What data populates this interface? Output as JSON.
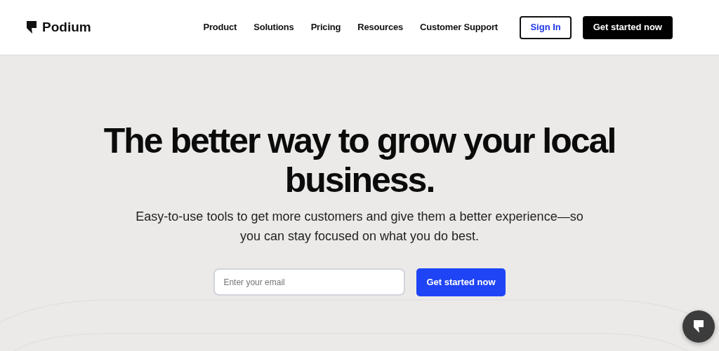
{
  "brand": {
    "name": "Podium"
  },
  "nav": {
    "links": [
      "Product",
      "Solutions",
      "Pricing",
      "Resources",
      "Customer Support"
    ]
  },
  "header_buttons": [
    {
      "label": "Sign In",
      "kind": "outline"
    },
    {
      "label": "Get started now",
      "kind": "dark"
    }
  ],
  "hero": {
    "title": "The better way to grow your local business.",
    "subtitle": "Easy-to-use tools to get more customers and give them a better experience—so you can stay focused on what you do best.",
    "email": {
      "placeholder": "Enter your email"
    },
    "cta": "Get started now"
  }
}
